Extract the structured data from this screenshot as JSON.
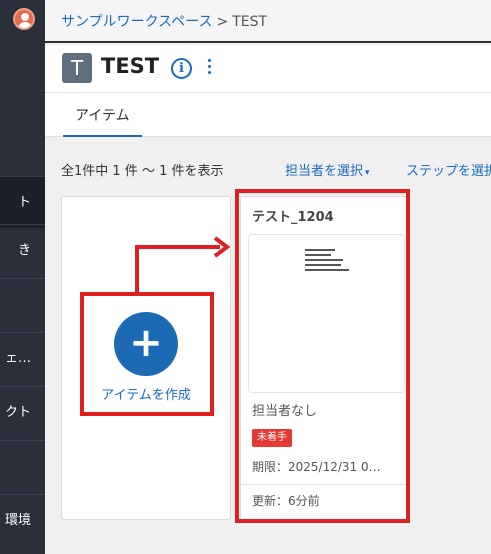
{
  "sidebar": {
    "items": [
      {
        "label": "ト",
        "active": true
      },
      {
        "label": "き"
      },
      {
        "label": ""
      },
      {
        "label": "ェ…"
      },
      {
        "label": "クト"
      },
      {
        "label": ""
      },
      {
        "label": "環境"
      }
    ]
  },
  "breadcrumb": {
    "workspace": "サンプルワークスペース",
    "separator": ">",
    "current": "TEST"
  },
  "header": {
    "icon_letter": "T",
    "title": "TEST",
    "info_icon": "i"
  },
  "tabs": [
    {
      "label": "アイテム",
      "active": true
    }
  ],
  "filters": {
    "count_text": "全1件中 1 件 ～ 1 件を表示",
    "assignee_label": "担当者を選択",
    "assignee_caret": "▾",
    "step_label": "ステップを選択"
  },
  "create_card": {
    "icon": "+",
    "label": "アイテムを作成"
  },
  "item_card": {
    "title": "テスト_1204",
    "assignee": "担当者なし",
    "status": "未着手",
    "due": "期限：2025/12/31 0…",
    "updated": "更新：6分前"
  },
  "colors": {
    "accent": "#1a6bbf",
    "sidebar_bg": "#2a2f3a",
    "annotation": "#e02020",
    "status_badge": "#e53935"
  }
}
